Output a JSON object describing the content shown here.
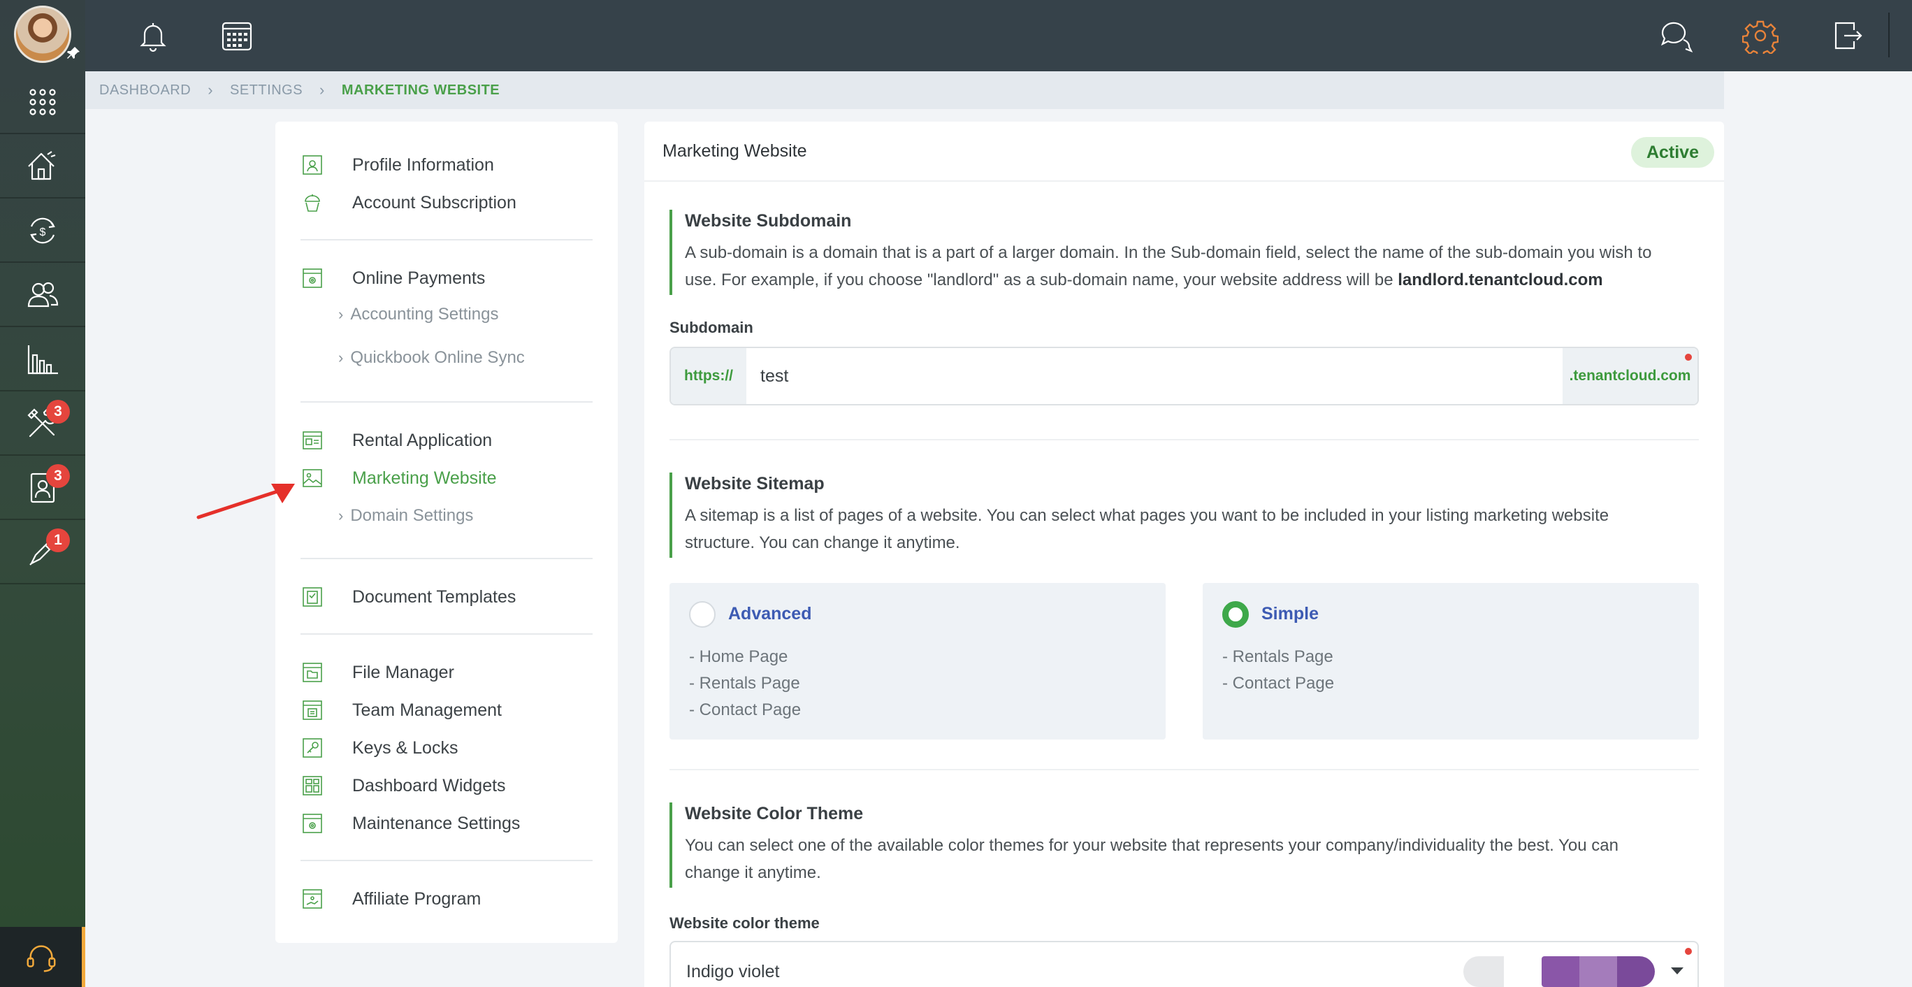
{
  "breadcrumb": {
    "items": [
      "DASHBOARD",
      "SETTINGS"
    ],
    "current": "MARKETING WEBSITE"
  },
  "rail": {
    "badges": {
      "tools": "3",
      "tenant_requests": "3",
      "pro_tools": "1"
    }
  },
  "settings_nav": {
    "groups": [
      [
        {
          "label": "Profile Information",
          "icon": "profile-icon"
        },
        {
          "label": "Account Subscription",
          "icon": "cupcake-icon"
        }
      ],
      [
        {
          "label": "Online Payments",
          "icon": "payment-settings-icon"
        },
        {
          "label": "Accounting Settings",
          "sub": true
        },
        {
          "label": "Quickbook Online Sync",
          "sub": true
        }
      ],
      [
        {
          "label": "Rental Application",
          "icon": "application-icon"
        },
        {
          "label": "Marketing Website",
          "icon": "image-icon",
          "active": true
        },
        {
          "label": "Domain Settings",
          "sub": true
        }
      ],
      [
        {
          "label": "Document Templates",
          "icon": "document-icon"
        }
      ],
      [
        {
          "label": "File Manager",
          "icon": "folder-icon"
        },
        {
          "label": "Team Management",
          "icon": "team-icon"
        },
        {
          "label": "Keys & Locks",
          "icon": "key-icon"
        },
        {
          "label": "Dashboard Widgets",
          "icon": "widgets-icon"
        },
        {
          "label": "Maintenance Settings",
          "icon": "gear-icon"
        }
      ],
      [
        {
          "label": "Affiliate Program",
          "icon": "affiliate-icon"
        }
      ]
    ]
  },
  "main": {
    "title": "Marketing Website",
    "status": "Active",
    "subdomain_section": {
      "title": "Website Subdomain",
      "desc_before": "A sub-domain is a domain that is a part of a larger domain. In the Sub-domain field, select the name of the sub-domain you wish to use. For example, if you choose \"landlord\" as a sub-domain name, your website address will be ",
      "desc_bold": "landlord.tenantcloud.com",
      "field_label": "Subdomain",
      "prefix": "https://",
      "value": "test",
      "suffix": ".tenantcloud.com"
    },
    "sitemap_section": {
      "title": "Website Sitemap",
      "desc": "A sitemap is a list of pages of a website. You can select what pages you want to be included in your listing marketing website structure. You can change it anytime.",
      "options": [
        {
          "label": "Advanced",
          "checked": false,
          "pages": [
            "- Home Page",
            "- Rentals Page",
            "- Contact Page"
          ]
        },
        {
          "label": "Simple",
          "checked": true,
          "pages": [
            "- Rentals Page",
            "- Contact Page"
          ]
        }
      ]
    },
    "color_section": {
      "title": "Website Color Theme",
      "desc": "You can select one of the available color themes for your website that represents your company/individuality the best. You can change it anytime.",
      "field_label": "Website color theme",
      "selected": "Indigo violet",
      "swatch_colors": [
        "#8a56a8",
        "#a47cbb",
        "#7a4a9a"
      ]
    }
  },
  "colors": {
    "accent": "#4aa04a",
    "status_bg": "#def2dc",
    "link": "#3d5bb3",
    "badge": "#e5453d"
  }
}
